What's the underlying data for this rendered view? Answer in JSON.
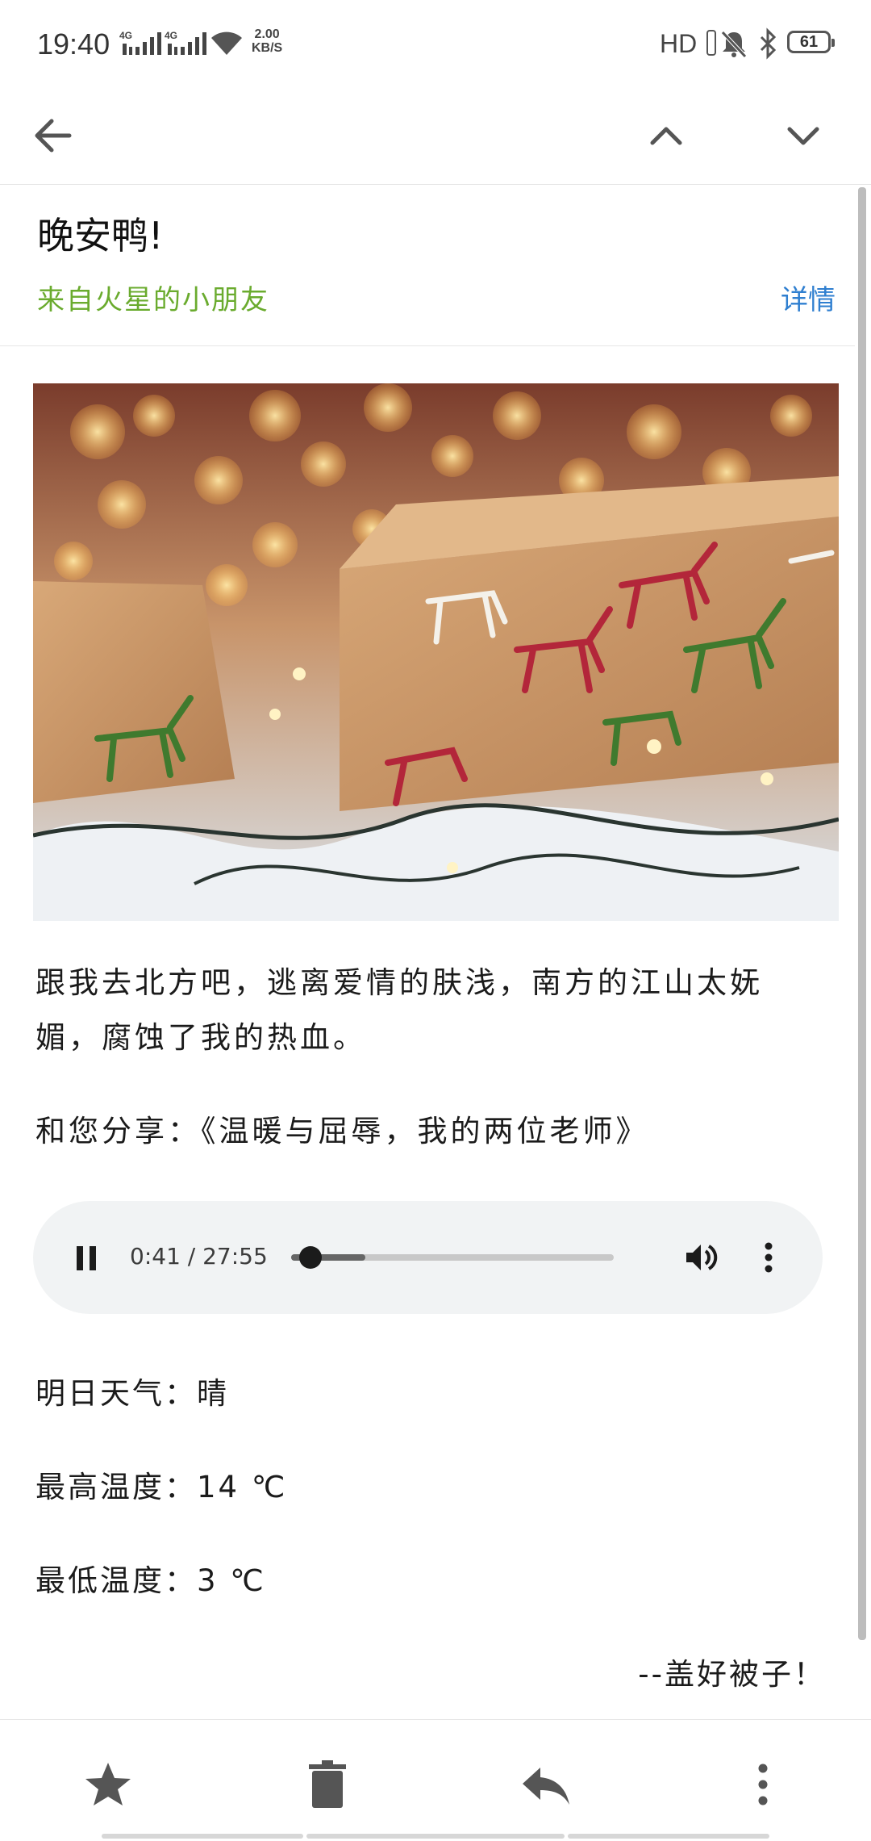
{
  "status": {
    "time": "19:40",
    "net1": "4G",
    "net2": "4G",
    "speed_value": "2.00",
    "speed_unit": "KB/S",
    "hd": "HD",
    "battery": "61"
  },
  "appbar": {
    "back_icon": "arrow-left-icon",
    "prev_icon": "chevron-up-icon",
    "next_icon": "chevron-down-icon"
  },
  "mail": {
    "subject": "晚安鸭!",
    "sender": "来自火星的小朋友",
    "details": "详情",
    "paragraph1": "跟我去北方吧，逃离爱情的肤浅，南方的江山太妩媚，腐蚀了我的热血。",
    "paragraph2": "和您分享：《温暖与屈辱，我的两位老师》",
    "weather": "明日天气：晴",
    "high": "最高温度：14 ℃",
    "low": "最低温度：3 ℃",
    "signoff": "--盖好被子！"
  },
  "player": {
    "time": "0:41 / 27:55",
    "progress": 0.025,
    "buffered": 0.23
  },
  "bottombar": {
    "star_icon": "star-icon",
    "delete_icon": "trash-icon",
    "reply_icon": "reply-icon",
    "more_icon": "more-vertical-icon"
  },
  "colors": {
    "sender": "#6aab2e",
    "details": "#2f7fd0",
    "player_bg": "#f1f3f4"
  }
}
